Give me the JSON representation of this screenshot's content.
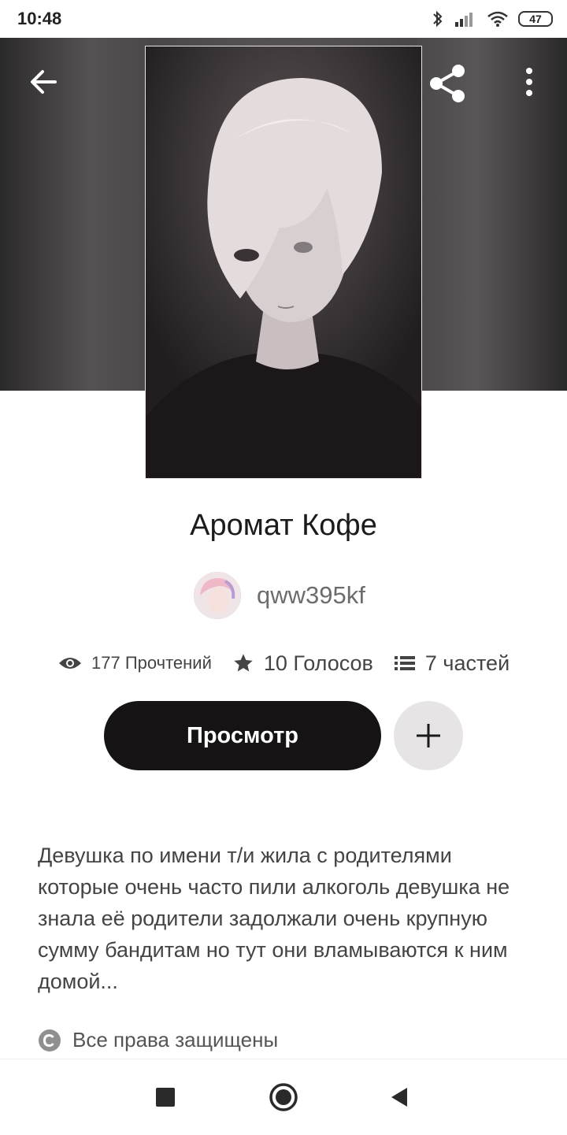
{
  "status_bar": {
    "time": "10:48",
    "battery": "47",
    "icons": [
      "bluetooth-icon",
      "signal-icon",
      "wifi-icon",
      "battery-icon"
    ]
  },
  "header": {
    "icons": [
      "back-arrow-icon",
      "share-icon",
      "more-vert-icon"
    ]
  },
  "story": {
    "title": "Аромат Кофе",
    "author": "qww395kf",
    "stats": {
      "reads": "177 Прочтений",
      "votes": "10 Голосов",
      "parts": "7 частей"
    },
    "view_button": "Просмотр",
    "description": "Девушка по имени т/и жила с родителями которые очень часто пили алкоголь девушка не знала её родители задолжали очень крупную сумму бандитам но тут они вламываются к ним домой...",
    "copyright": "Все права защищены"
  },
  "colors": {
    "primary_button": "#161314",
    "add_button": "#e6e4e5",
    "text_muted": "#6c6c6c"
  },
  "nav_bar": {
    "icons": [
      "recents-square-icon",
      "home-circle-icon",
      "back-triangle-icon"
    ]
  }
}
